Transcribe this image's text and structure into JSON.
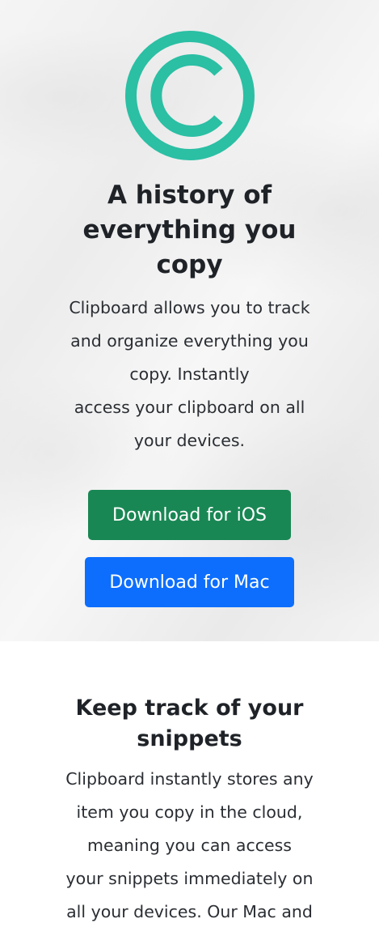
{
  "hero": {
    "logo_icon": "copyright-icon",
    "logo_color": "#2bbfa4",
    "title_lines": [
      "A history of",
      "everything you",
      "copy"
    ],
    "description_lines": [
      "Clipboard allows you to track",
      "and organize everything you",
      "copy. Instantly",
      "access your clipboard on all",
      "your devices."
    ],
    "ios_button_label": "Download for iOS",
    "mac_button_label": "Download for Mac",
    "ios_button_color": "#198754",
    "mac_button_color": "#0d6efd"
  },
  "snippets": {
    "title_lines": [
      "Keep track of your",
      "snippets"
    ],
    "description_lines": [
      "Clipboard instantly stores any",
      "item you copy in the cloud,",
      "meaning you can access",
      "your snippets immediately on",
      "all your devices. Our Mac and"
    ]
  }
}
